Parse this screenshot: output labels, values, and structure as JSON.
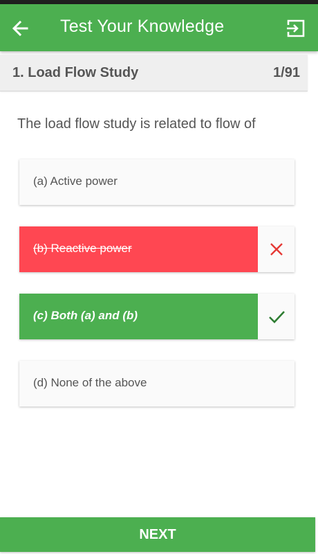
{
  "app_bar": {
    "title": "Test Your Knowledge",
    "back_icon": "arrow-left-icon",
    "exit_icon": "exit-icon"
  },
  "quiz": {
    "topic": "1. Load Flow Study",
    "progress": "1/91",
    "question": "The load flow study is related to flow of",
    "options": [
      {
        "label": "(a) Active power",
        "state": "default"
      },
      {
        "label": "(b) Reactive power",
        "state": "wrong"
      },
      {
        "label": "(c) Both (a) and (b)",
        "state": "correct"
      },
      {
        "label": "(d) None of the above",
        "state": "default"
      }
    ]
  },
  "footer": {
    "next_label": "NEXT"
  },
  "colors": {
    "primary": "#4caf50",
    "wrong": "#ff4752",
    "correct_check": "#2e7d32",
    "wrong_cross": "#e53935"
  }
}
